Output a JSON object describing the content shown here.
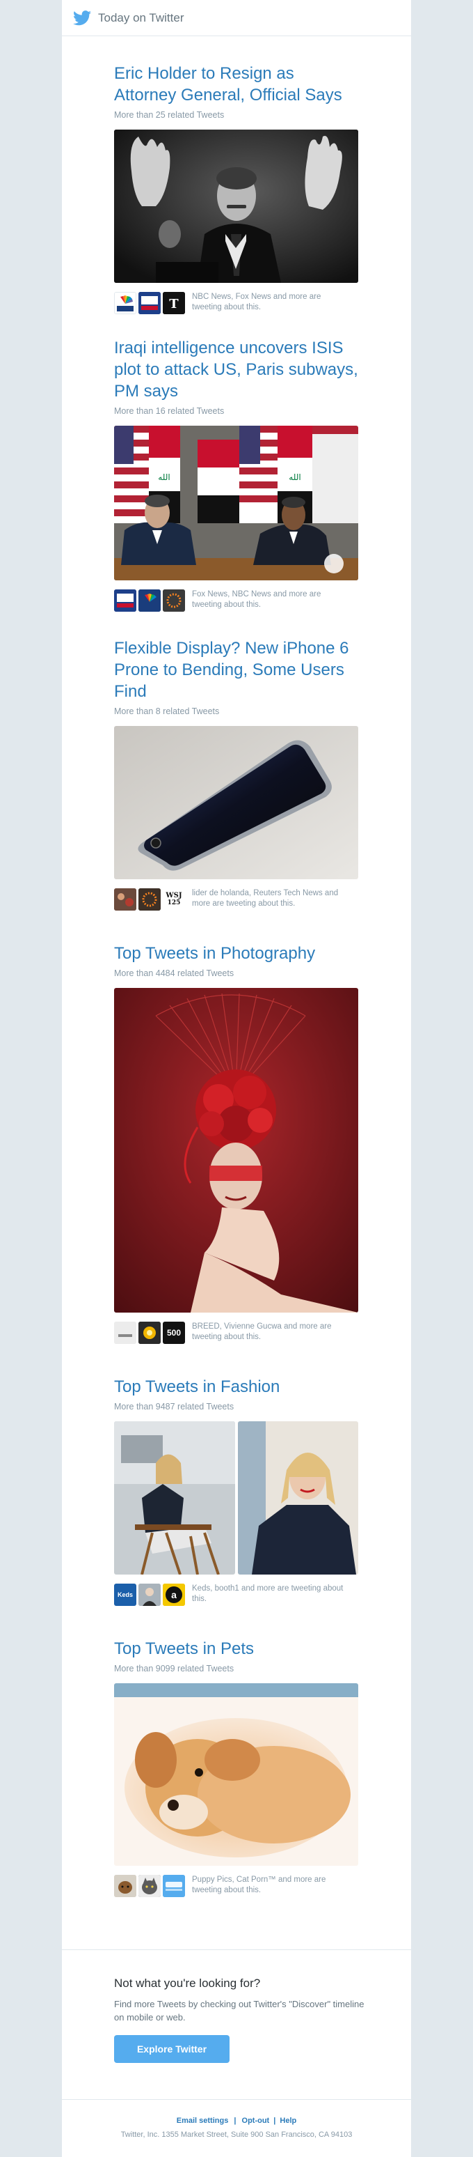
{
  "header": {
    "title": "Today on Twitter"
  },
  "stories": [
    {
      "headline": "Eric Holder to Resign as Attorney General, Official Says",
      "related": "More than 25 related Tweets",
      "sources_text": "NBC News, Fox News and more are tweeting about this.",
      "sources": [
        "NBC NEWS",
        "FOX NEWS",
        "NYT"
      ]
    },
    {
      "headline": "Iraqi intelligence uncovers ISIS plot to attack US, Paris subways, PM says",
      "related": "More than 16 related Tweets",
      "sources_text": "Fox News, NBC News and more are tweeting about this.",
      "sources": [
        "FOX NEWS",
        "NBC NEWS",
        "REUTERS"
      ]
    },
    {
      "headline": "Flexible Display? New iPhone 6 Prone to Bending, Some Users Find",
      "related": "More than 8 related Tweets",
      "sources_text": "lider de holanda, Reuters Tech News and more are tweeting about this.",
      "sources": [
        "lider de holanda",
        "Reuters Tech",
        "WSJ 125"
      ]
    },
    {
      "headline": "Top Tweets in Photography",
      "related": "More than 4484 related Tweets",
      "sources_text": "BREED, Vivienne Gucwa and more are tweeting about this.",
      "sources": [
        "BREED",
        "Vivienne Gucwa",
        "500"
      ]
    },
    {
      "headline": "Top Tweets in Fashion",
      "related": "More than 9487 related Tweets",
      "sources_text": "Keds, booth1 and more are tweeting about this.",
      "sources": [
        "Keds",
        "booth1",
        "a"
      ]
    },
    {
      "headline": "Top Tweets in Pets",
      "related": "More than 9099 related Tweets",
      "sources_text": "Puppy Pics, Cat Porn™ and more are tweeting about this.",
      "sources": [
        "Puppy Pics",
        "Cat Porn",
        "Twitter"
      ]
    }
  ],
  "footer": {
    "question": "Not what you're looking for?",
    "hint": "Find more Tweets by checking out Twitter's \"Discover\" timeline on mobile or web.",
    "button": "Explore Twitter",
    "link_email": "Email settings",
    "sep1": "|",
    "link_optout": "Opt-out",
    "sep2": "|",
    "link_help": "Help",
    "address": "Twitter, Inc. 1355 Market Street, Suite 900 San Francisco, CA 94103"
  },
  "colors": {
    "accent": "#55acee",
    "link": "#2b7bb9",
    "background": "#e1e8ed",
    "muted": "#8899a6"
  }
}
